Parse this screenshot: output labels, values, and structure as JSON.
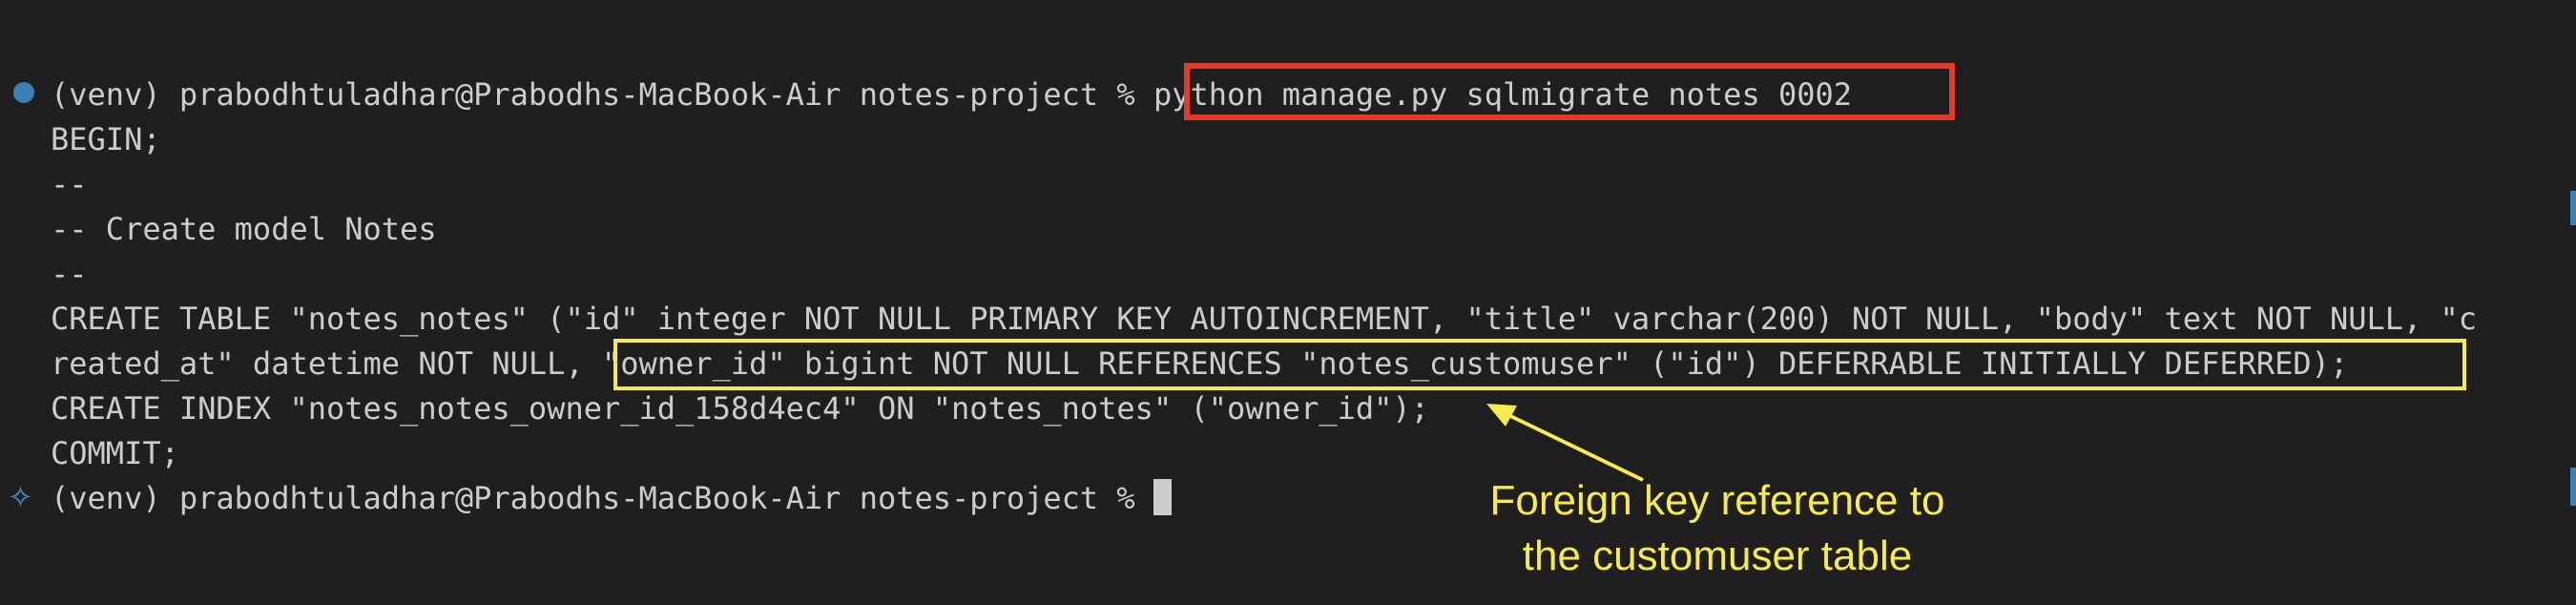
{
  "terminal": {
    "command_line": {
      "prompt": "(venv) prabodhtuladhar@Prabodhs-MacBook-Air notes-project % ",
      "command": "python manage.py sqlmigrate notes 0002"
    },
    "output": [
      "BEGIN;",
      "--",
      "-- Create model Notes",
      "--",
      "CREATE TABLE \"notes_notes\" (\"id\" integer NOT NULL PRIMARY KEY AUTOINCREMENT, \"title\" varchar(200) NOT NULL, \"body\" text NOT NULL, \"c",
      "reated_at\" datetime NOT NULL, ",
      "CREATE INDEX \"notes_notes_owner_id_158d4ec4\" ON \"notes_notes\" (\"owner_id\");",
      "COMMIT;"
    ],
    "highlighted_fragment": "\"owner_id\" bigint NOT NULL REFERENCES \"notes_customuser\" (\"id\") DEFERRABLE INITIALLY DEFERRED);",
    "final_prompt": "(venv) prabodhtuladhar@Prabodhs-MacBook-Air notes-project % "
  },
  "annotation": {
    "line1": "Foreign key reference to",
    "line2": "the customuser table",
    "highlight_color": "#f6ea4e",
    "command_box_color": "#e33b2b"
  },
  "icons": {
    "status": "status-dot-icon",
    "assistant": "sparkle-icon"
  }
}
